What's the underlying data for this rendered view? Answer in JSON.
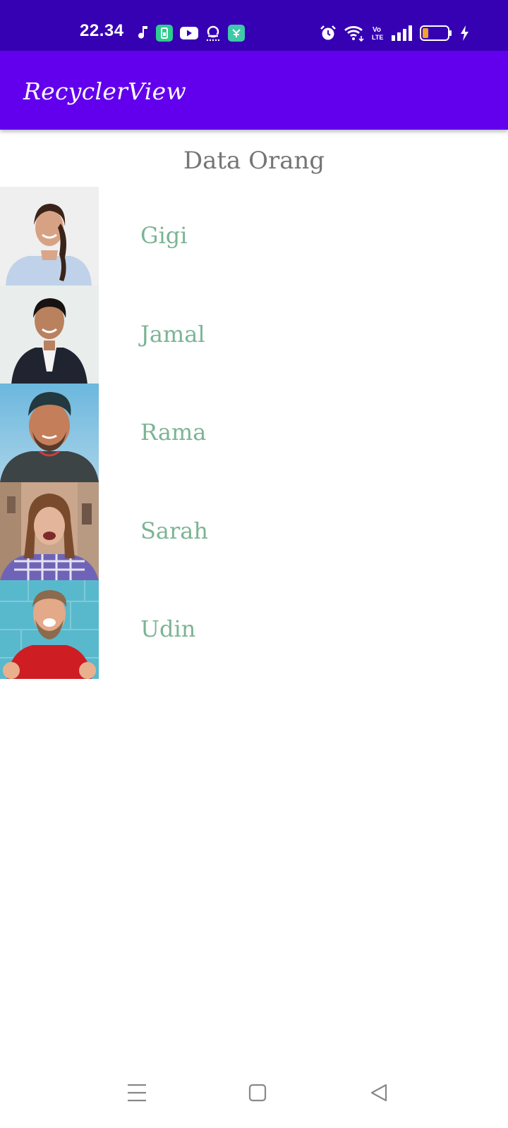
{
  "status_bar": {
    "time": "22.34",
    "left_icons": [
      "music-note-icon",
      "phone-cleaner-icon",
      "youtube-icon",
      "podcast-icon",
      "app-store-icon"
    ],
    "right_icons": [
      "alarm-icon",
      "wifi-icon",
      "volte-icon",
      "signal-icon",
      "battery-icon",
      "charging-icon"
    ],
    "volte_text": "Vo LTE",
    "background": "#3600B3"
  },
  "app_bar": {
    "title": "RecyclerView",
    "background": "#6200EE"
  },
  "content": {
    "heading": "Data Orang",
    "persons": [
      {
        "name": "Gigi"
      },
      {
        "name": "Jamal"
      },
      {
        "name": "Rama"
      },
      {
        "name": "Sarah"
      },
      {
        "name": "Udin"
      }
    ],
    "name_color": "#7CB494"
  },
  "nav_bar": {
    "buttons": [
      "menu-icon",
      "home-icon",
      "back-icon"
    ]
  }
}
